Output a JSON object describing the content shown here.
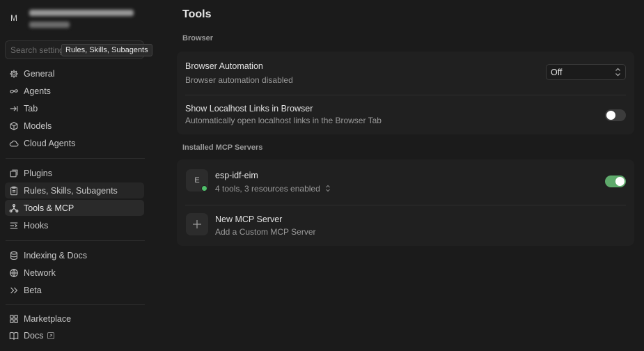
{
  "account": {
    "avatar_initial": "M"
  },
  "search": {
    "placeholder": "Search settings"
  },
  "tooltip": {
    "text": "Rules, Skills, Subagents"
  },
  "sidebar": {
    "items": [
      {
        "label": "General",
        "icon": "gear-icon"
      },
      {
        "label": "Agents",
        "icon": "infinity-icon"
      },
      {
        "label": "Tab",
        "icon": "tab-arrow-icon"
      },
      {
        "label": "Models",
        "icon": "cube-icon"
      },
      {
        "label": "Cloud Agents",
        "icon": "cloud-icon"
      },
      {
        "label": "Plugins",
        "icon": "plugin-icon"
      },
      {
        "label": "Rules, Skills, Subagents",
        "icon": "clipboard-icon"
      },
      {
        "label": "Tools & MCP",
        "icon": "network-icon"
      },
      {
        "label": "Hooks",
        "icon": "hooks-icon"
      },
      {
        "label": "Indexing & Docs",
        "icon": "database-icon"
      },
      {
        "label": "Network",
        "icon": "globe-icon"
      },
      {
        "label": "Beta",
        "icon": "chevrons-right-icon"
      },
      {
        "label": "Marketplace",
        "icon": "grid-icon"
      },
      {
        "label": "Docs",
        "icon": "book-icon"
      }
    ],
    "active": "Tools & MCP",
    "hovered": "Rules, Skills, Subagents"
  },
  "main": {
    "title": "Tools",
    "browser_section": {
      "label": "Browser",
      "automation": {
        "title": "Browser Automation",
        "subtitle": "Browser automation disabled",
        "value": "Off"
      },
      "localhost": {
        "title": "Show Localhost Links in Browser",
        "subtitle": "Automatically open localhost links in the Browser Tab",
        "enabled": false
      }
    },
    "mcp_section": {
      "label": "Installed MCP Servers",
      "servers": [
        {
          "initial": "E",
          "name": "esp-idf-eim",
          "details": "4 tools, 3 resources enabled",
          "enabled": true,
          "status": "connected"
        }
      ],
      "new_server": {
        "title": "New MCP Server",
        "subtitle": "Add a Custom MCP Server"
      }
    }
  },
  "colors": {
    "background": "#1b1b1b",
    "card": "#202020",
    "toggle_on": "#5ea96b",
    "status_dot": "#4fbf6a"
  }
}
